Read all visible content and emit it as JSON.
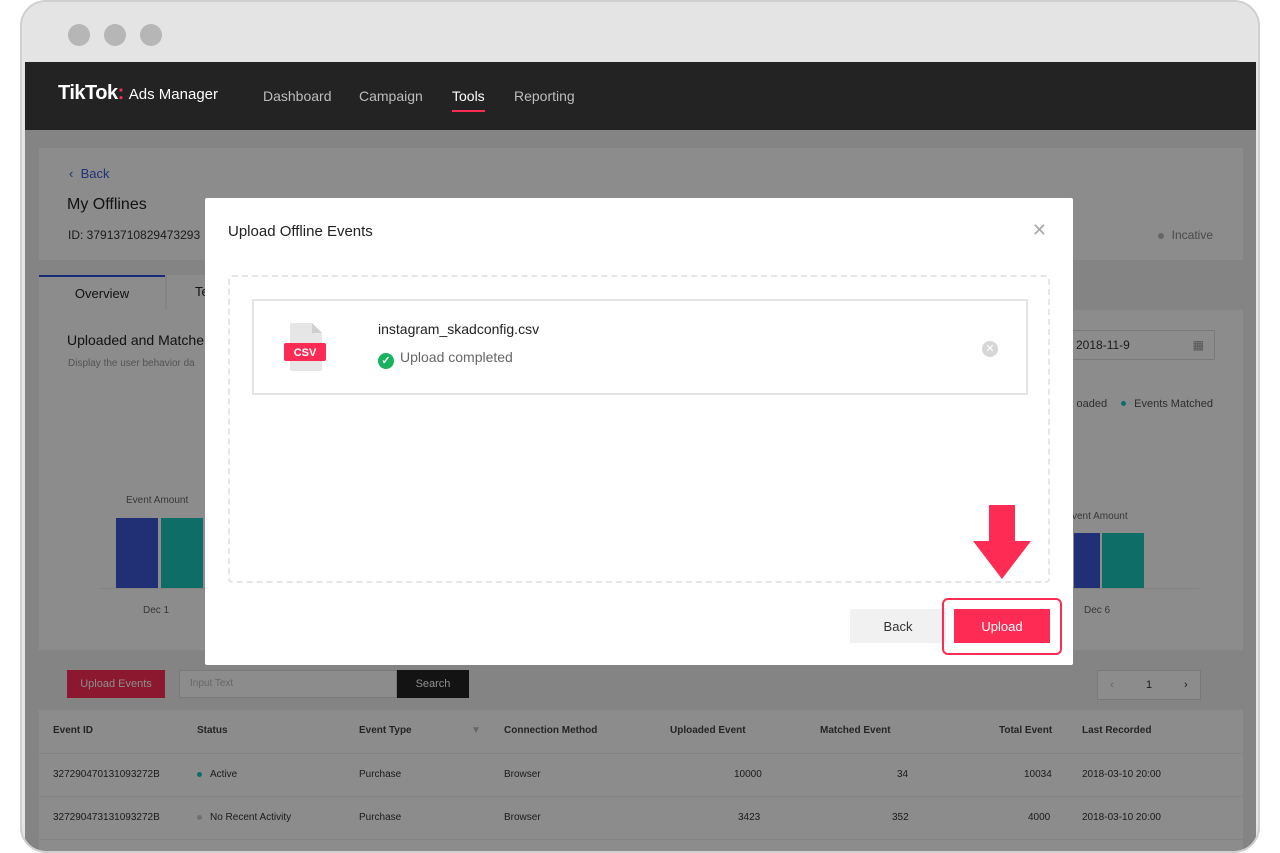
{
  "brand": {
    "name": "TikTok",
    "product": "Ads Manager",
    "accent": "#fe2c55"
  },
  "nav": {
    "items": [
      {
        "label": "Dashboard"
      },
      {
        "label": "Campaign"
      },
      {
        "label": "Tools"
      },
      {
        "label": "Reporting"
      }
    ],
    "active": "Tools"
  },
  "header": {
    "back_label": "Back",
    "title": "My Offlines",
    "id_text": "ID: 37913710829473293",
    "status": "Incative"
  },
  "tabs": [
    {
      "label": "Overview"
    },
    {
      "label": "Te"
    }
  ],
  "chart": {
    "title": "Uploaded and Matche",
    "subtitle": "Display the user behavior da",
    "date": "2018-11-9",
    "legend_left": "oaded",
    "legend_right": "Events Matched",
    "axis_left": "Event Amount",
    "axis_right": "vent Amount",
    "x_left": "Dec 1",
    "x_right": "Dec 6"
  },
  "toolbar": {
    "upload_events": "Upload Events",
    "search_placeholder": "Input Text",
    "search_button": "Search",
    "page": "1"
  },
  "table": {
    "columns": [
      "Event ID",
      "Status",
      "Event Type",
      "Connection Method",
      "Uploaded Event",
      "Matched Event",
      "Total Event",
      "Last Recorded"
    ],
    "rows": [
      {
        "id": "327290470131093272B",
        "status": "Active",
        "type": "Purchase",
        "method": "Browser",
        "uploaded": "10000",
        "matched": "34",
        "total": "10034",
        "last": "2018-03-10 20:00"
      },
      {
        "id": "327290473131093272B",
        "status": "No Recent Activity",
        "type": "Purchase",
        "method": "Browser",
        "uploaded": "3423",
        "matched": "352",
        "total": "4000",
        "last": "2018-03-10 20:00"
      }
    ]
  },
  "modal": {
    "title": "Upload Offline Events",
    "file": {
      "icon_label": "CSV",
      "name": "instagram_skadconfig.csv",
      "status": "Upload completed"
    },
    "back_button": "Back",
    "upload_button": "Upload"
  },
  "icons": {
    "close": "close-icon",
    "check": "check-circle-icon",
    "remove": "remove-circle-icon",
    "calendar": "calendar-icon",
    "arrow": "arrow-down-icon"
  }
}
